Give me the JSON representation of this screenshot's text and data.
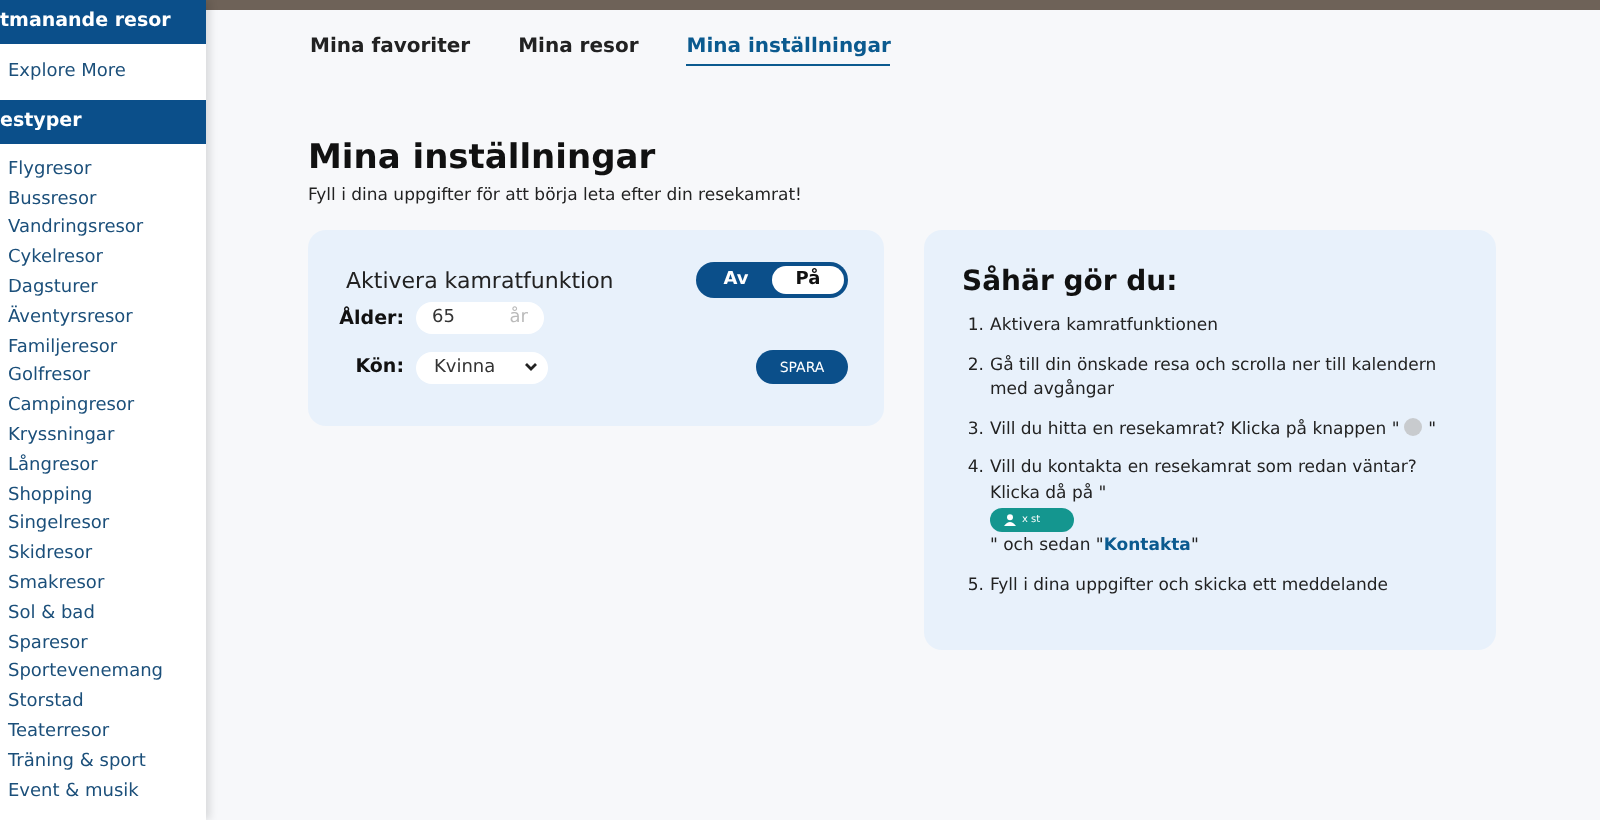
{
  "sidebar": {
    "sections": [
      {
        "title": "tmanande resor",
        "items": [
          {
            "label": "Explore More"
          }
        ]
      },
      {
        "title": "estyper",
        "items": [
          {
            "label": "Flygresor"
          },
          {
            "label": "Bussresor"
          },
          {
            "label": "Vandringsresor"
          },
          {
            "label": "Cykelresor"
          },
          {
            "label": "Dagsturer"
          },
          {
            "label": "Äventyrsresor"
          },
          {
            "label": "Familjeresor"
          },
          {
            "label": "Golfresor"
          },
          {
            "label": "Campingresor"
          },
          {
            "label": "Kryssningar"
          },
          {
            "label": "Långresor"
          },
          {
            "label": "Shopping"
          },
          {
            "label": "Singelresor"
          },
          {
            "label": "Skidresor"
          },
          {
            "label": "Smakresor"
          },
          {
            "label": "Sol & bad"
          },
          {
            "label": "Sparesor"
          },
          {
            "label": "Sportevenemang"
          },
          {
            "label": "Storstad"
          },
          {
            "label": "Teaterresor"
          },
          {
            "label": "Träning & sport"
          },
          {
            "label": "Event & musik"
          }
        ]
      }
    ]
  },
  "tabs": [
    {
      "label": "Mina favoriter",
      "selected": false
    },
    {
      "label": "Mina resor",
      "selected": false
    },
    {
      "label": "Mina inställningar",
      "selected": true
    }
  ],
  "heading": "Mina inställningar",
  "intro": "Fyll i dina uppgifter för att börja leta efter din resekamrat!",
  "settings": {
    "toggle_label": "Aktivera kamratfunktion",
    "toggle": {
      "off_label": "Av",
      "on_label": "På",
      "on": true
    },
    "age": {
      "label": "Ålder:",
      "value": "65",
      "unit": "år"
    },
    "gender": {
      "label": "Kön:",
      "value": "Kvinna"
    },
    "save_button": "SPARA"
  },
  "howto": {
    "title": "Såhär gör du:",
    "steps": [
      {
        "number": "1.",
        "parts": [
          {
            "kind": "text",
            "text": "Aktivera kamratfunktionen"
          }
        ]
      },
      {
        "number": "2.",
        "parts": [
          {
            "kind": "text",
            "text": "Gå till din önskade resa och scrolla ner till kalendern med avgångar"
          }
        ]
      },
      {
        "number": "3.",
        "parts": [
          {
            "kind": "text",
            "text": "Vill du hitta en resekamrat? Klicka på knappen \""
          },
          {
            "kind": "dot"
          },
          {
            "kind": "text",
            "text": "\""
          }
        ]
      },
      {
        "number": "4.",
        "parts": [
          {
            "kind": "text",
            "text": "Vill du kontakta en resekamrat som redan väntar? Klicka då på \""
          },
          {
            "kind": "badge",
            "text": "x st"
          },
          {
            "kind": "text",
            "text": "\" och sedan \"**Kontakta**\""
          }
        ]
      },
      {
        "number": "5.",
        "parts": [
          {
            "kind": "text",
            "text": "Fyll i dina uppgifter och skicka ett meddelande"
          }
        ]
      }
    ]
  }
}
